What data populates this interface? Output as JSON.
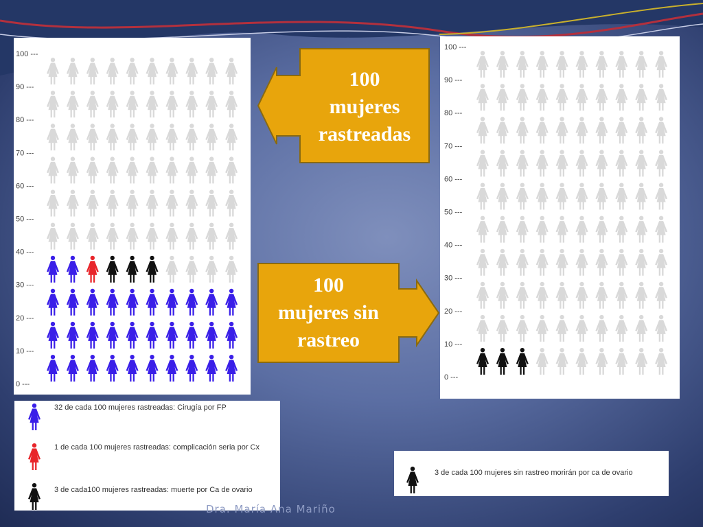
{
  "colors": {
    "screened_surgery": "#3a1fe8",
    "complication": "#e8262b",
    "death": "#111111",
    "neutral": "#d9d9d9",
    "callout_fill": "#e8a50c",
    "callout_border": "#8a6a10"
  },
  "icon": "woman-icon",
  "callouts": {
    "screened": {
      "line1": "100",
      "line2": "mujeres",
      "line3": "rastreadas",
      "arrow": "left"
    },
    "unscreened": {
      "line1": "100",
      "line2": "mujeres sin",
      "line3": "rastreo",
      "arrow": "right"
    }
  },
  "chart_data": [
    {
      "type": "pictogram",
      "title": "",
      "total": 100,
      "columns": 10,
      "y_ticks": [
        "0 ---",
        "10 ---",
        "20 ---",
        "30 ---",
        "40 ---",
        "50 ---",
        "60 ---",
        "70 ---",
        "80 ---",
        "90 ---",
        "100 ---"
      ],
      "categories": [
        {
          "label": "32 de cada 100 mujeres rastreadas: Cirugía por FP",
          "count": 32,
          "color": "#3a1fe8"
        },
        {
          "label": "1 de cada 100 mujeres rastreadas: complicación seria por Cx",
          "count": 1,
          "color": "#e8262b"
        },
        {
          "label": "3 de cada100 mujeres rastreadas: muerte por Ca de ovario",
          "count": 3,
          "color": "#111111"
        }
      ],
      "remaining": {
        "count": 64,
        "color": "#d9d9d9"
      }
    },
    {
      "type": "pictogram",
      "title": "",
      "total": 100,
      "columns": 10,
      "y_ticks": [
        "0 ---",
        "10 ---",
        "20 ---",
        "30 ---",
        "40 ---",
        "50 ---",
        "60 ---",
        "70 ---",
        "80 ---",
        "90 ---",
        "100 ---"
      ],
      "categories": [
        {
          "label": "3 de cada 100 mujeres sin rastreo morirán por ca de ovario",
          "count": 3,
          "color": "#111111"
        }
      ],
      "remaining": {
        "count": 97,
        "color": "#d9d9d9"
      }
    }
  ],
  "footer": {
    "author": "Dra. María Ana Mariño"
  }
}
